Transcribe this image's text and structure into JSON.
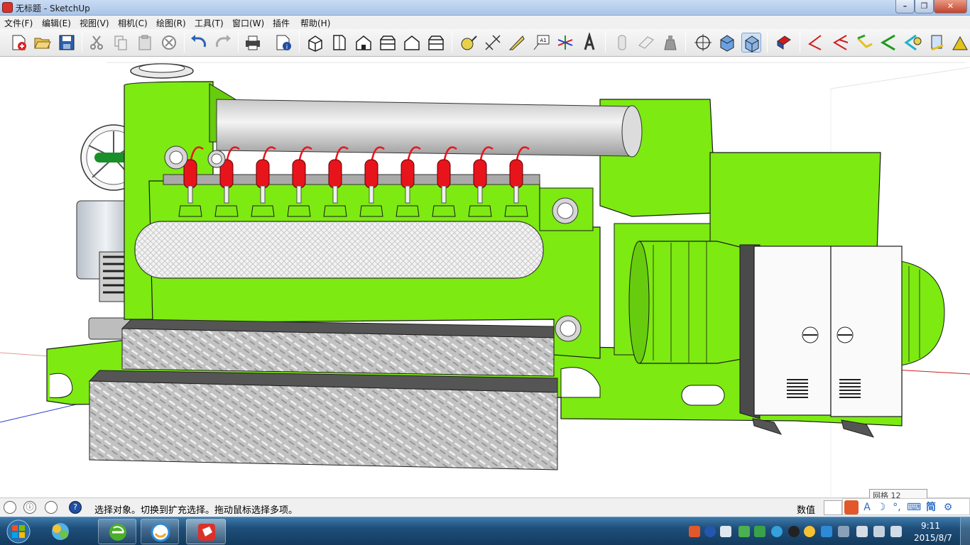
{
  "window": {
    "title": "无标题 - SketchUp",
    "minimize_glyph": "–",
    "maximize_glyph": "❐",
    "close_glyph": "✕"
  },
  "menu": {
    "items": [
      "文件(F)",
      "编辑(E)",
      "视图(V)",
      "相机(C)",
      "绘图(R)",
      "工具(T)",
      "窗口(W)",
      "插件",
      "帮助(H)"
    ]
  },
  "toolbar": {
    "icons": [
      "new-file-icon",
      "open-file-icon",
      "save-icon",
      "cut-icon",
      "copy-icon",
      "paste-icon",
      "erase-icon",
      "undo-icon",
      "redo-icon",
      "print-icon",
      "model-info-icon",
      "iso-view-icon",
      "top-view-icon",
      "front-view-icon",
      "right-view-icon",
      "back-view-icon",
      "left-view-icon",
      "tape-measure-icon",
      "dimension-icon",
      "protractor-icon",
      "text-icon",
      "axes-icon",
      "3d-text-icon",
      "xray-icon",
      "wireframe-icon",
      "hidden-line-icon",
      "orbit-icon",
      "shaded-icon",
      "shaded-textures-icon",
      "component-icon",
      "line-tool-icon",
      "arc-tool-icon",
      "freehand-icon",
      "sandbox-icon",
      "gear-plugin-icon",
      "calc-plugin-icon"
    ],
    "text_icon_label": "A1"
  },
  "status": {
    "hint": "选择对象。切换到扩充选择。拖动鼠标选择多项。",
    "vcb_label": "数值",
    "grid_tooltip": "网格 12",
    "help_glyph": "?",
    "info_glyph": "ⓘ"
  },
  "ime": {
    "items": [
      "A",
      "☽",
      "°,",
      "⌨",
      "简",
      "⚙"
    ]
  },
  "taskbar": {
    "clock_time": "9:11",
    "clock_date": "2015/8/7",
    "apps": [
      "windows-explorer",
      "ie-browser",
      "qq-browser",
      "sketchup"
    ]
  },
  "colors": {
    "engine_green": "#7dea12",
    "engine_outline": "#1a1a1a",
    "plug_red": "#e8141c",
    "pipe_gray": "#d6d6d6",
    "plate_gray": "#bdbdbd"
  }
}
